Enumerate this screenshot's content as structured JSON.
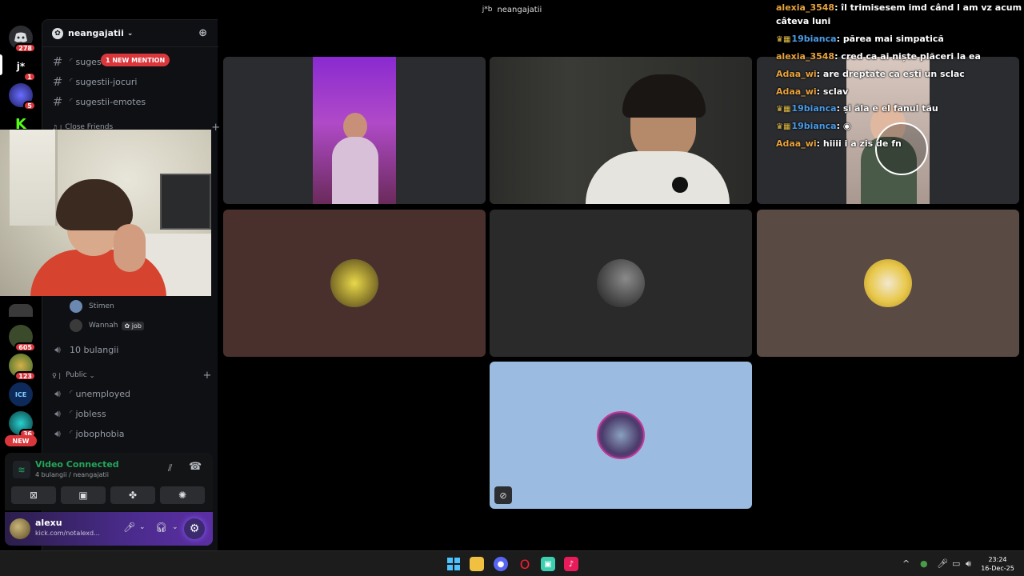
{
  "window": {
    "title": "neangajatii",
    "title_icon": "j*b"
  },
  "rail": {
    "servers": [
      {
        "glyph": "",
        "badge": "278",
        "color": "#2b2d31"
      },
      {
        "glyph": "j*",
        "badge": "1",
        "color": "#000000"
      },
      {
        "glyph": "",
        "badge": "5",
        "color": "#2c2f8a"
      },
      {
        "glyph": "K",
        "badge": "",
        "color": "#000000"
      },
      {
        "glyph": "",
        "badge": "605",
        "color": "#3a4a2a"
      },
      {
        "glyph": "",
        "badge": "123",
        "color": "#4a6a3a"
      },
      {
        "glyph": "",
        "badge": "",
        "color": "#1a3a6a"
      },
      {
        "glyph": "",
        "badge": "36",
        "color": "#1a4a4a"
      }
    ],
    "new_label": "NEW"
  },
  "sidebar": {
    "guild_name": "neangajatii",
    "mention_pill": "1 NEW MENTION",
    "text_channels": [
      "sugestii",
      "sugestii-jocuri",
      "sugestii-emotes"
    ],
    "category_close_friends": "Close Friends",
    "voice_users": [
      {
        "name": "Stimen",
        "tag": ""
      },
      {
        "name": "Wannah",
        "tag": "job"
      }
    ],
    "voice_channel": "10 bulangii",
    "category_public": "Public",
    "public_channels": [
      "unemployed",
      "jobless",
      "jobophobia"
    ]
  },
  "rtc": {
    "status": "Video Connected",
    "subtitle": "4 bulangii / neangajatii"
  },
  "user": {
    "name": "alexu",
    "status": "kick.com/notalexd..."
  },
  "chat": {
    "messages": [
      {
        "user": "alexia_3548",
        "text": "îl trimisesem imd când l am vz acum",
        "badges": false,
        "blue": false
      },
      {
        "user": "",
        "text": "câteva luni",
        "badges": false,
        "blue": false
      },
      {
        "user": "19bianca",
        "text": "părea mai simpatică",
        "badges": true,
        "blue": true
      },
      {
        "user": "alexia_3548",
        "text": "cred ca ai niște plăceri la ea",
        "badges": false,
        "blue": false
      },
      {
        "user": "Adaa_wi",
        "text": "are dreptate ca esti un sclac",
        "badges": false,
        "blue": false
      },
      {
        "user": "Adaa_wi",
        "text": "sclav",
        "badges": false,
        "blue": false
      },
      {
        "user": "19bianca",
        "text": "și ăla e el fanul tău",
        "badges": true,
        "blue": true
      },
      {
        "user": "19bianca",
        "text": "",
        "badges": true,
        "blue": true
      },
      {
        "user": "Adaa_wi",
        "text": "hiiii i a zis de fn",
        "badges": false,
        "blue": false
      }
    ]
  },
  "taskbar": {
    "time": "23:24",
    "date": "16-Dec-25"
  },
  "colors": {
    "accent_green": "#23a55a",
    "mention_red": "#da373c",
    "chat_user_orange": "#e8a33d",
    "chat_user_blue": "#4b9ce8"
  }
}
